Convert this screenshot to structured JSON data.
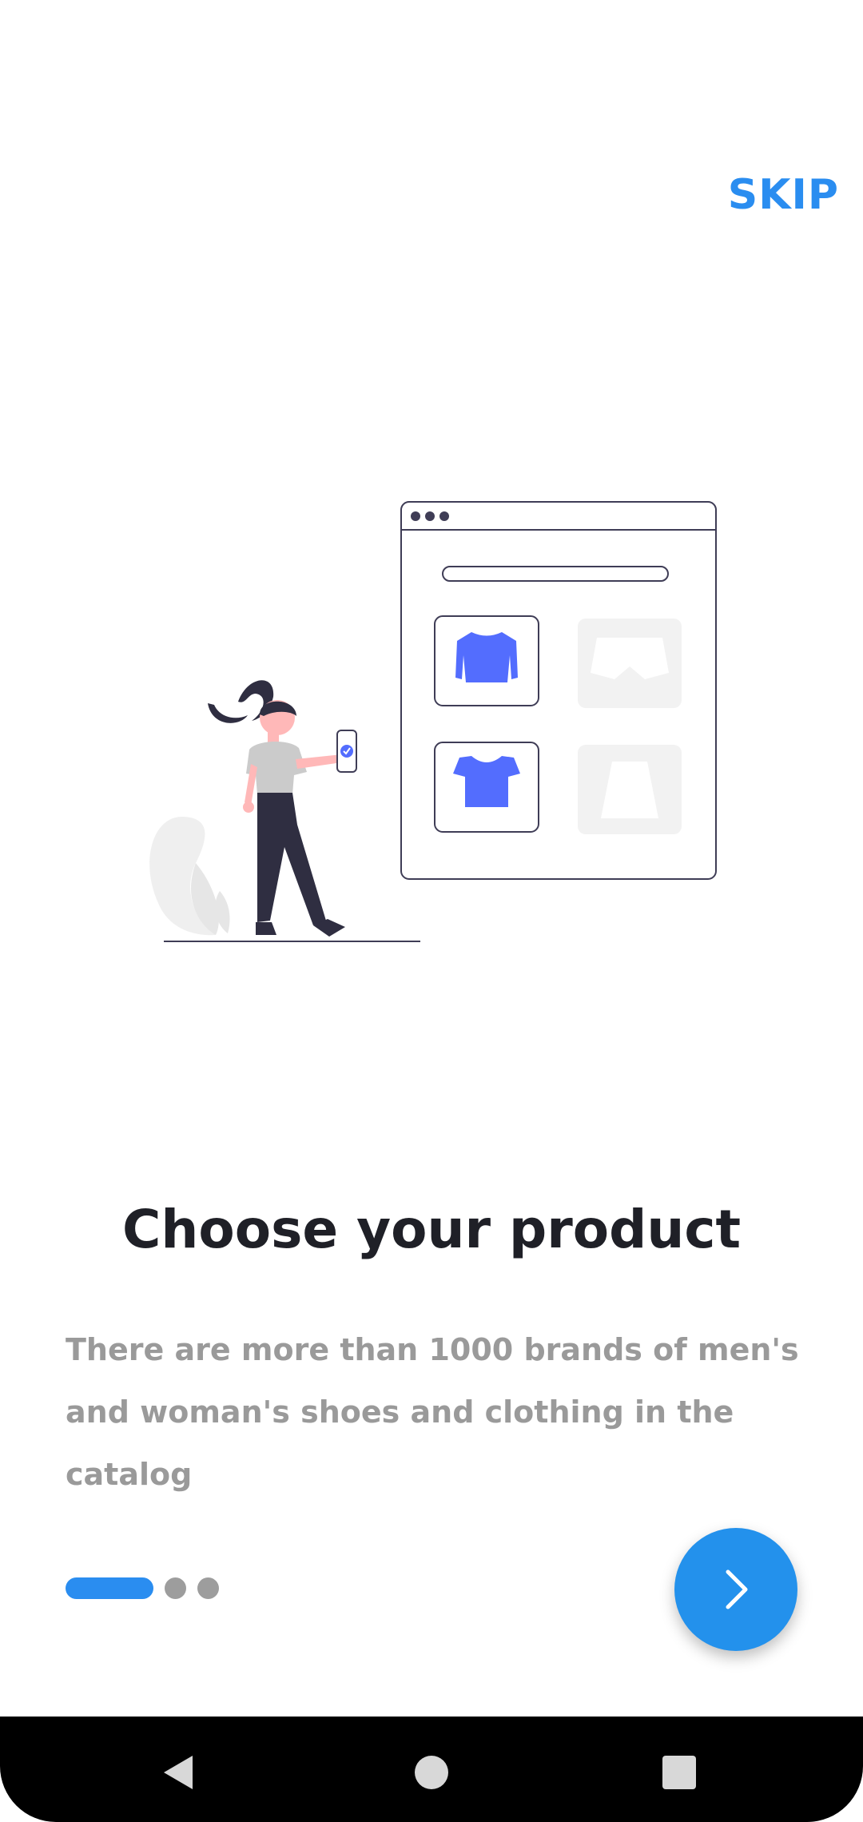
{
  "header": {
    "skip_label": "SKIP"
  },
  "onboarding": {
    "title": "Choose your product",
    "description": "There are more than 1000 brands of men's and woman's shoes and clothing in the catalog",
    "page_indicator": {
      "current": 1,
      "total": 3
    }
  },
  "colors": {
    "accent": "#2a8df0",
    "title": "#1f2027",
    "description": "#9a9a9a",
    "illustration_accent": "#536dfe"
  },
  "icons": {
    "next": "chevron-right-icon",
    "nav_back": "back-triangle-icon",
    "nav_home": "home-circle-icon",
    "nav_recents": "recents-square-icon"
  }
}
